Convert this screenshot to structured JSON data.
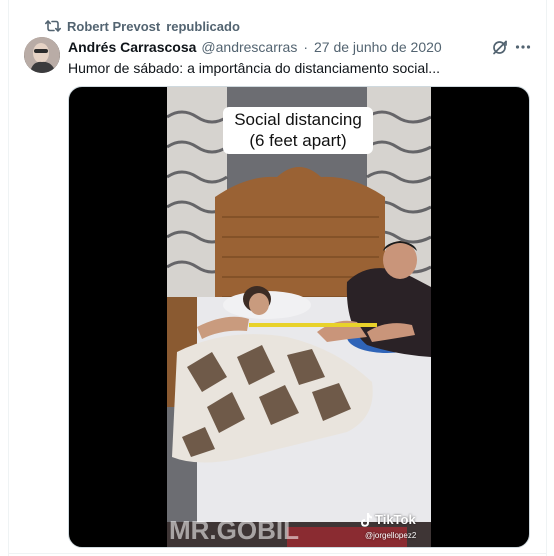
{
  "repost": {
    "reposter": "Robert Prevost",
    "action": "republicado",
    "icon": "repost-icon"
  },
  "post": {
    "author_name": "Andrés Carrascosa",
    "author_handle": "@andrescarras",
    "separator": "·",
    "date": "27 de junho de 2020",
    "text": "Humor de sábado: a importância do distanciamento social...",
    "icons": [
      "grok-icon",
      "more-icon"
    ]
  },
  "media": {
    "caption": "Social distancing\n(6 feet apart)",
    "tiktok_label": "TikTok",
    "tiktok_user": "@jorgellopez2",
    "watermark": "MR.GOBIL"
  },
  "colors": {
    "text_primary": "#0f1419",
    "text_secondary": "#536471",
    "border": "#eff3f4",
    "media_bg": "#000000"
  }
}
